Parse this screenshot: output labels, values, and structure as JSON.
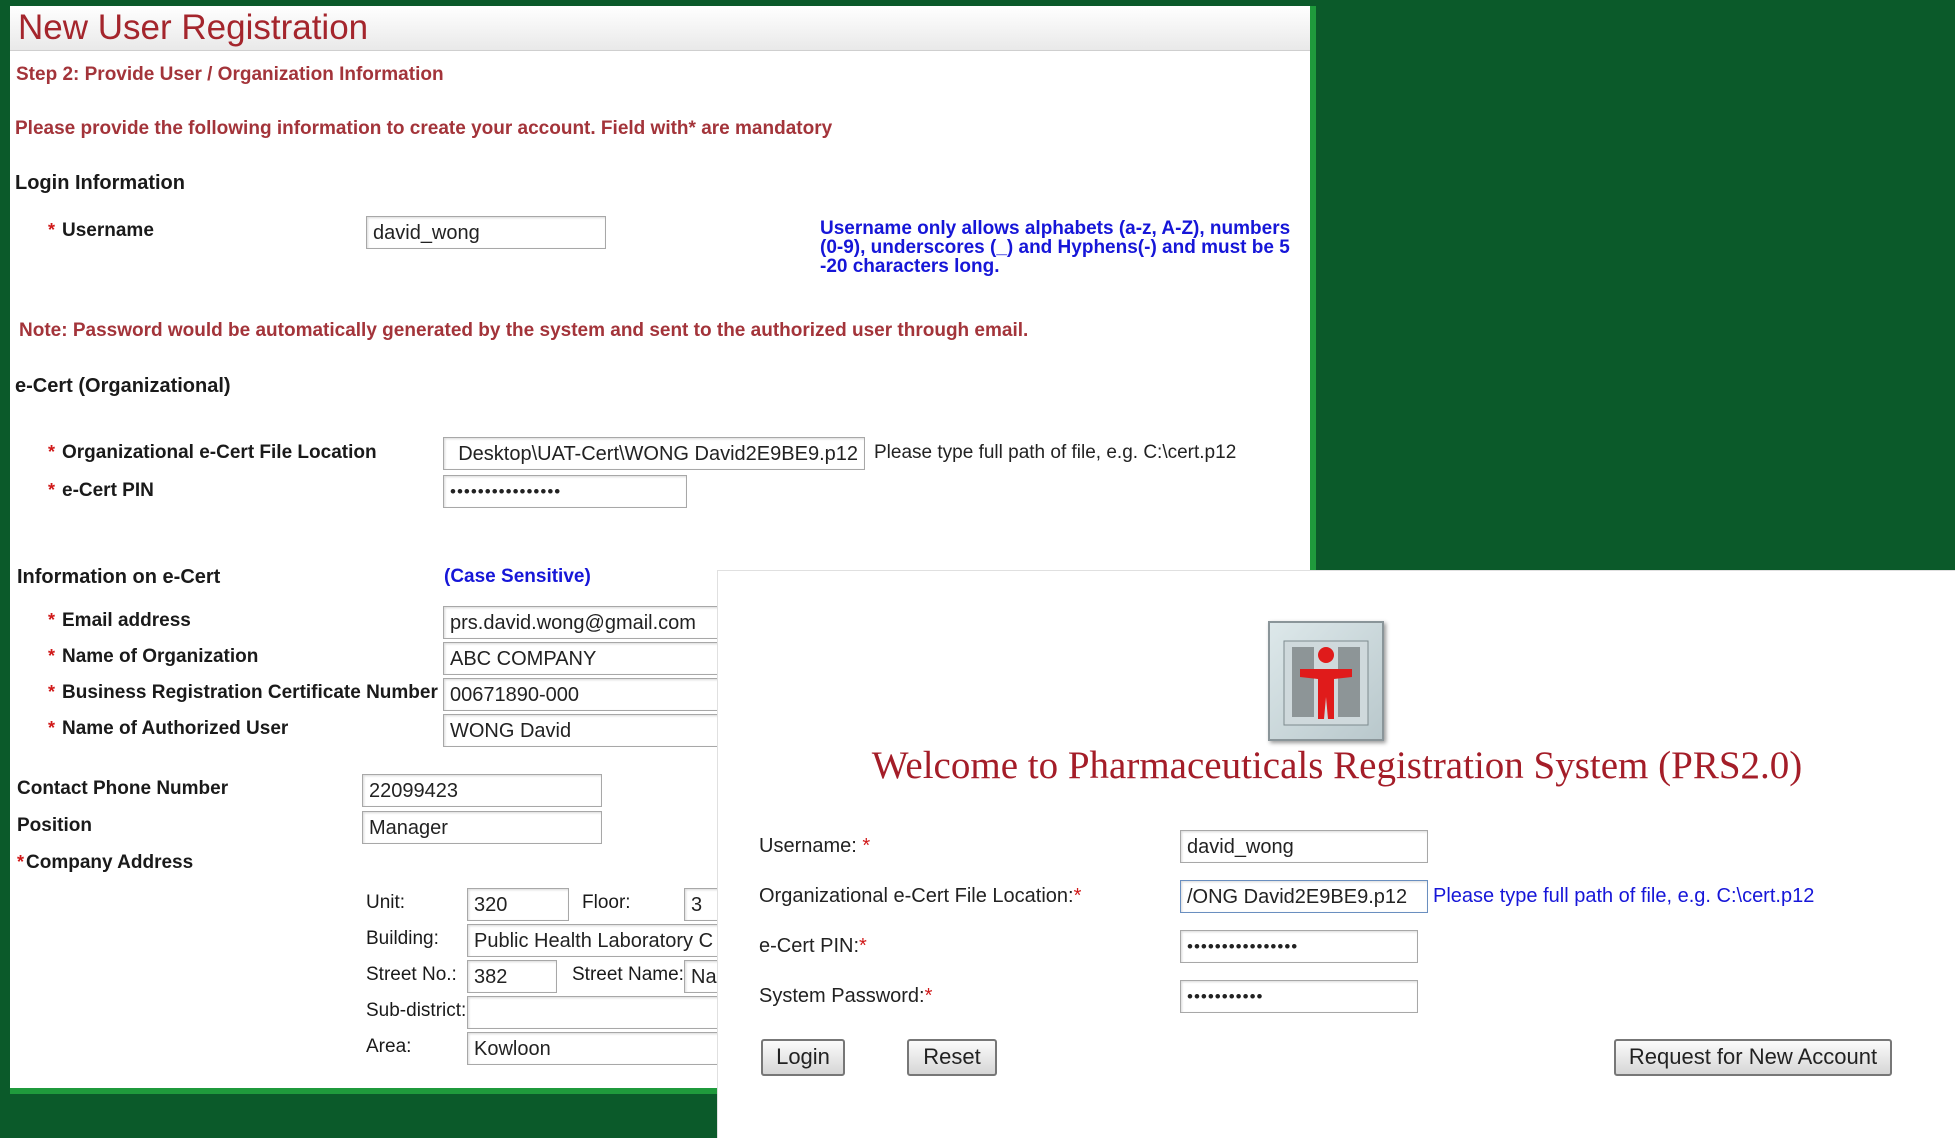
{
  "registration": {
    "title": "New User Registration",
    "step": "Step 2: Provide User / Organization Information",
    "instructions": "Please provide the following information to create your account. Field with* are mandatory",
    "login_section": "Login Information",
    "username_label": "Username",
    "username_value": "david_wong",
    "username_hint": [
      "Username only allows alphabets (a-z, A-Z), numbers",
      "(0-9), underscores (_) and Hyphens(-) and must be 5",
      "-20 characters long."
    ],
    "note": "Note: Password would be automatically generated by the system and sent to the authorized user through email.",
    "ecert_section": "e-Cert (Organizational)",
    "ecert_file_label": "Organizational e-Cert File Location",
    "ecert_file_value": "Desktop\\UAT-Cert\\WONG David2E9BE9.p12",
    "ecert_file_hint": "Please type full path of file, e.g. C:\\cert.p12",
    "ecert_pin_label": "e-Cert PIN",
    "ecert_pin_value": "••••••••••••••••",
    "info_section": "Information on e-Cert",
    "case_sensitive": "(Case Sensitive)",
    "email_label": "Email address",
    "email_value": "prs.david.wong@gmail.com",
    "org_label": "Name of Organization",
    "org_value": "ABC COMPANY",
    "brc_label": "Business Registration Certificate Number",
    "brc_value": "00671890-000",
    "auth_user_label": "Name of Authorized User",
    "auth_user_value": "WONG David",
    "phone_label": "Contact Phone Number",
    "phone_value": "22099423",
    "position_label": "Position",
    "position_value": "Manager",
    "address_label": "Company Address",
    "unit_label": "Unit:",
    "unit_value": "320",
    "floor_label": "Floor:",
    "floor_value": "3",
    "building_label": "Building:",
    "building_value": "Public Health Laboratory C",
    "street_no_label": "Street No.:",
    "street_no_value": "382",
    "street_name_label": "Street Name:",
    "street_name_value": "Na",
    "subdistrict_label": "Sub-district:",
    "subdistrict_value": "",
    "area_label": "Area:",
    "area_value": "Kowloon",
    "star": "*"
  },
  "login": {
    "welcome": "Welcome to Pharmaceuticals Registration System (PRS2.0)",
    "username_label": "Username:",
    "username_value": "david_wong",
    "ecert_file_label": "Organizational e-Cert File Location:",
    "ecert_file_value": "/ONG David2E9BE9.p12",
    "ecert_file_hint": "Please type full path of file, e.g. C:\\cert.p12",
    "ecert_pin_label": "e-Cert PIN:",
    "ecert_pin_value": "••••••••••••••••",
    "system_password_label": "System Password:",
    "system_password_value": "•••••••••••",
    "login_button": "Login",
    "reset_button": "Reset",
    "request_button": "Request for New Account",
    "star": "*"
  },
  "colors": {
    "background": "#0b5a2a",
    "accent_border": "#1f9a3c",
    "title_red": "#a4252c",
    "hint_blue": "#1616d8"
  },
  "icons": {
    "logo": "prs-logo-icon"
  }
}
